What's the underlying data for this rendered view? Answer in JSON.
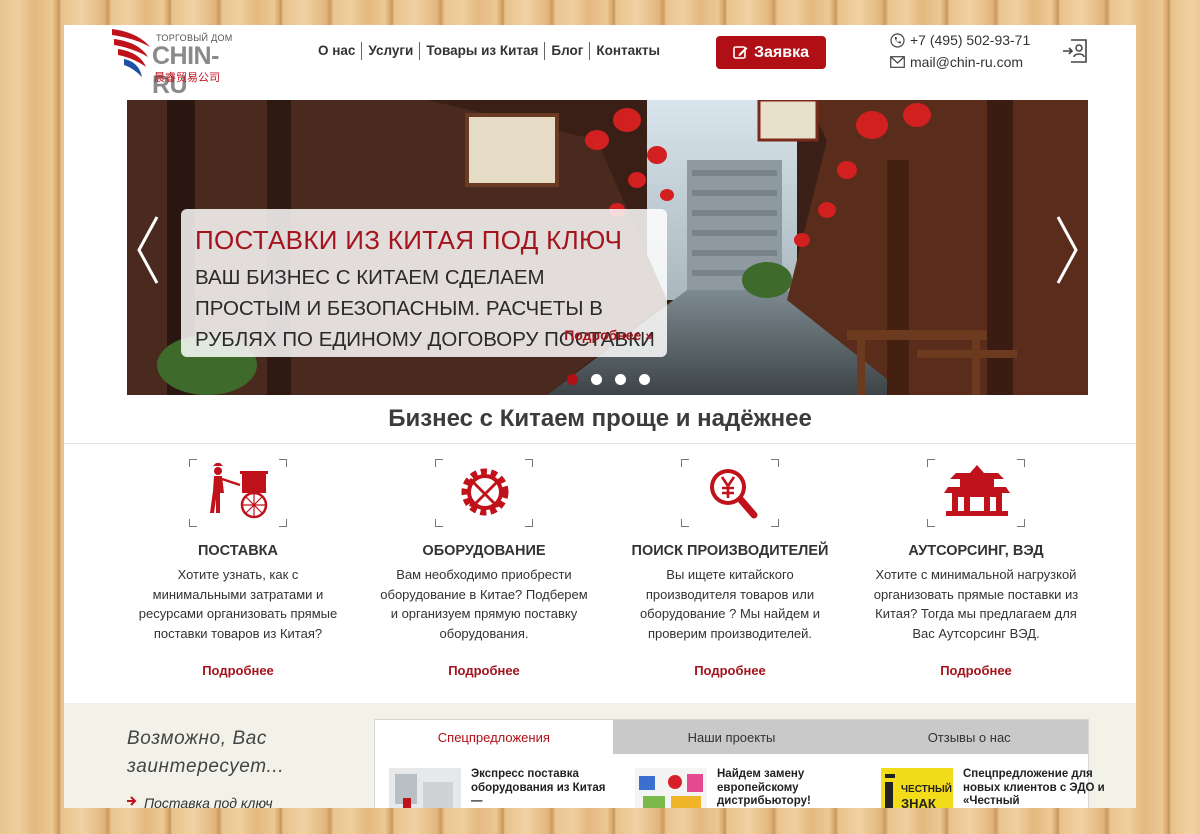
{
  "logo": {
    "tagline": "ТОРГОВЫЙ ДОМ",
    "name": "CHIN-RU",
    "chinese": "晨睿贸易公司"
  },
  "nav": [
    {
      "label": "О нас"
    },
    {
      "label": "Услуги"
    },
    {
      "label": "Товары из Китая"
    },
    {
      "label": "Блог"
    },
    {
      "label": "Контакты"
    }
  ],
  "header": {
    "request_button": "Заявка",
    "phone": "+7 (495) 502-93-71",
    "email": "mail@chin-ru.com"
  },
  "slider": {
    "title": "ПОСТАВКИ ИЗ КИТАЯ ПОД КЛЮЧ",
    "text": "ВАШ БИЗНЕС С КИТАЕМ СДЕЛАЕМ ПРОСТЫМ И БЕЗОПАСНЫМ. РАСЧЕТЫ В РУБЛЯХ ПО ЕДИНОМУ ДОГОВОРУ ПОСТАВКИ",
    "more": "Подробнее »",
    "dots_count": 4,
    "active_dot": 1
  },
  "headline": "Бизнес с Китаем проще и надёжнее",
  "features": [
    {
      "icon": "rickshaw-icon",
      "title": "ПОСТАВКА",
      "text": "Хотите узнать, как с минимальными затратами и ресурсами организовать прямые поставки товаров из Китая?",
      "more": "Подробнее"
    },
    {
      "icon": "gear-wrench-icon",
      "title": "ОБОРУДОВАНИЕ",
      "text": "Вам необходимо приобрести оборудование в Китае? Подберем и организуем прямую поставку оборудования.",
      "more": "Подробнее"
    },
    {
      "icon": "yuan-search-icon",
      "title": "ПОИСК ПРОИЗВОДИТЕЛЕЙ",
      "text": "Вы ищете китайского производителя товаров или оборудование ? Мы найдем и проверим производителей.",
      "more": "Подробнее"
    },
    {
      "icon": "pagoda-icon",
      "title": "АУТСОРСИНГ, ВЭД",
      "text": "Хотите с минимальной нагрузкой организовать прямые поставки из Китая? Тогда мы предлагаем для Вас Аутсорсинг ВЭД.",
      "more": "Подробнее"
    }
  ],
  "sidebar": {
    "heading_line1": "Возможно, Вас",
    "heading_line2": "заинтересует...",
    "link": "Поставка под ключ"
  },
  "tabs": [
    {
      "label": "Спецпредложения",
      "active": true
    },
    {
      "label": "Наши проекты",
      "active": false
    },
    {
      "label": "Отзывы о нас",
      "active": false
    }
  ],
  "offers": [
    {
      "text": "Экспресс поставка оборудования из Китая —"
    },
    {
      "text": "Найдем замену европейскому дистрибьютору!"
    },
    {
      "text": "Спецпредложение для новых клиентов с ЭДО и «Честный"
    }
  ],
  "offer_thumb3_label": "ЧЕСТНЫЙ ЗНАК",
  "colors": {
    "brand_red": "#b00f16",
    "accent_red": "#a3141c",
    "tab_gray": "#c9c9c9",
    "bottom_bg": "#f3f2e8"
  }
}
